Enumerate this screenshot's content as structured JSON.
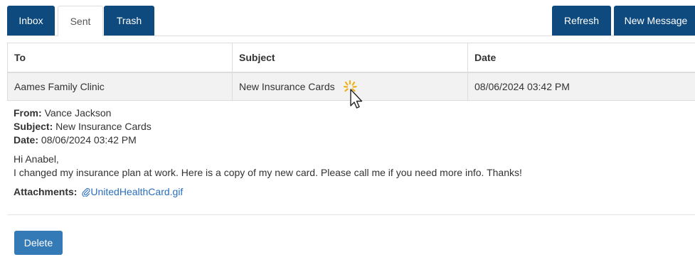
{
  "tabs": [
    {
      "label": "Inbox"
    },
    {
      "label": "Sent"
    },
    {
      "label": "Trash"
    }
  ],
  "toolbar": {
    "refresh_label": "Refresh",
    "new_message_label": "New Message"
  },
  "table": {
    "headers": {
      "to": "To",
      "subject": "Subject",
      "date": "Date"
    },
    "rows": [
      {
        "to": "Aames Family Clinic",
        "subject": "New Insurance Cards",
        "date": "08/06/2024 03:42 PM"
      }
    ]
  },
  "message": {
    "from_label": "From:",
    "from_value": "Vance Jackson",
    "subject_label": "Subject:",
    "subject_value": "New Insurance Cards",
    "date_label": "Date:",
    "date_value": "08/06/2024 03:42 PM",
    "greeting": "Hi Anabel,",
    "body": "I changed my insurance plan at work. Here is a copy of my new card. Please call me if you need more info. Thanks!",
    "attachments_label": "Attachments:",
    "attachment_name": "UnitedHealthCard.gif"
  },
  "actions": {
    "delete_label": "Delete"
  },
  "colors": {
    "tab_dark": "#0e4a7e",
    "delete_button": "#337ab7",
    "link": "#2a6fbf",
    "row_bg": "#f2f2f2"
  },
  "icons": {
    "attachment": "paperclip-icon",
    "cursor": "busy-pointer-cursor-icon"
  }
}
